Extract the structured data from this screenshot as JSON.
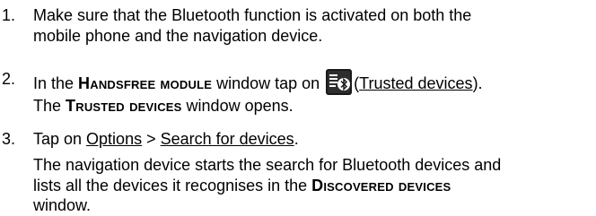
{
  "steps": [
    {
      "number": "1.",
      "lines": [
        "Make sure that the Bluetooth function is activated on both the",
        "mobile phone and the navigation device."
      ]
    },
    {
      "number": "2.",
      "line1": {
        "prefix": "In the ",
        "window_name": "Handsfree module",
        "middle": " window tap on ",
        "icon": "trusted-devices-bluetooth-icon",
        "open_paren": "(",
        "link": "Trusted devices",
        "close": ")."
      },
      "result": {
        "prefix": "The ",
        "window_name": "Trusted devices",
        "suffix": " window opens."
      }
    },
    {
      "number": "3.",
      "line1": {
        "prefix": "Tap on ",
        "link1": "Options",
        "separator": " > ",
        "link2": "Search for devices",
        "suffix": "."
      },
      "result": {
        "line1": "The navigation device starts the search for Bluetooth devices and",
        "line2_prefix": "lists all the devices it recognises in the ",
        "window_name": "Discovered devices",
        "line3": "window."
      }
    }
  ],
  "colors": {
    "text": "#000000",
    "icon_background": "#1a1a1a",
    "icon_glyph": "#ffffff"
  }
}
